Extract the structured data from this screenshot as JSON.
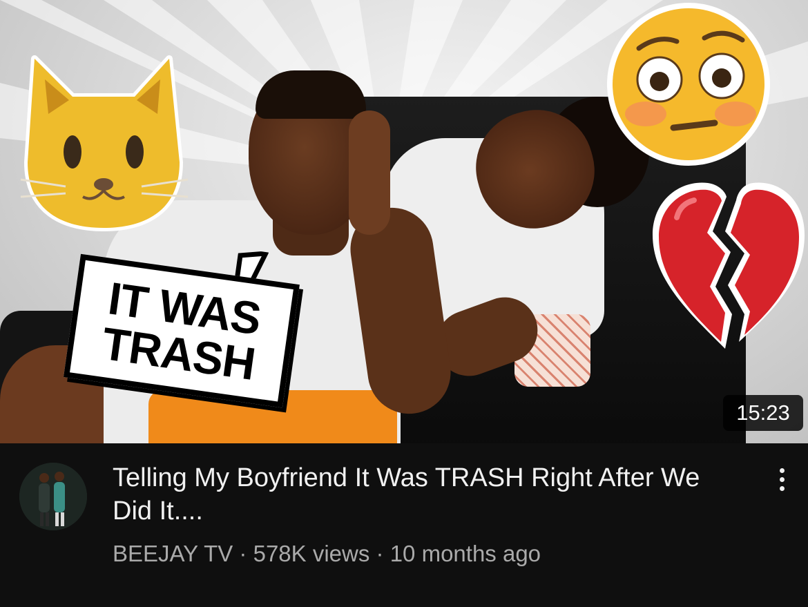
{
  "video": {
    "duration": "15:23",
    "title": "Telling My Boyfriend It Was TRASH Right After We Did It....",
    "channel": "BEEJAY TV",
    "separator": "·",
    "views": "578K views",
    "age": "10 months ago"
  },
  "thumbnail": {
    "bubble_text_line1": "IT WAS",
    "bubble_text_line2": "TRASH",
    "emojis": [
      "cat-face-icon",
      "flushed-face-icon",
      "broken-heart-icon"
    ]
  },
  "icons": {
    "menu": "more-vertical-icon"
  },
  "colors": {
    "background": "#0f0f0f",
    "title_text": "#f1f1f1",
    "meta_text": "#aaaaaa",
    "duration_bg": "#000000",
    "shorts_orange": "#f08a1a",
    "heart_red": "#d6232a",
    "emoji_yellow": "#f5c026"
  }
}
